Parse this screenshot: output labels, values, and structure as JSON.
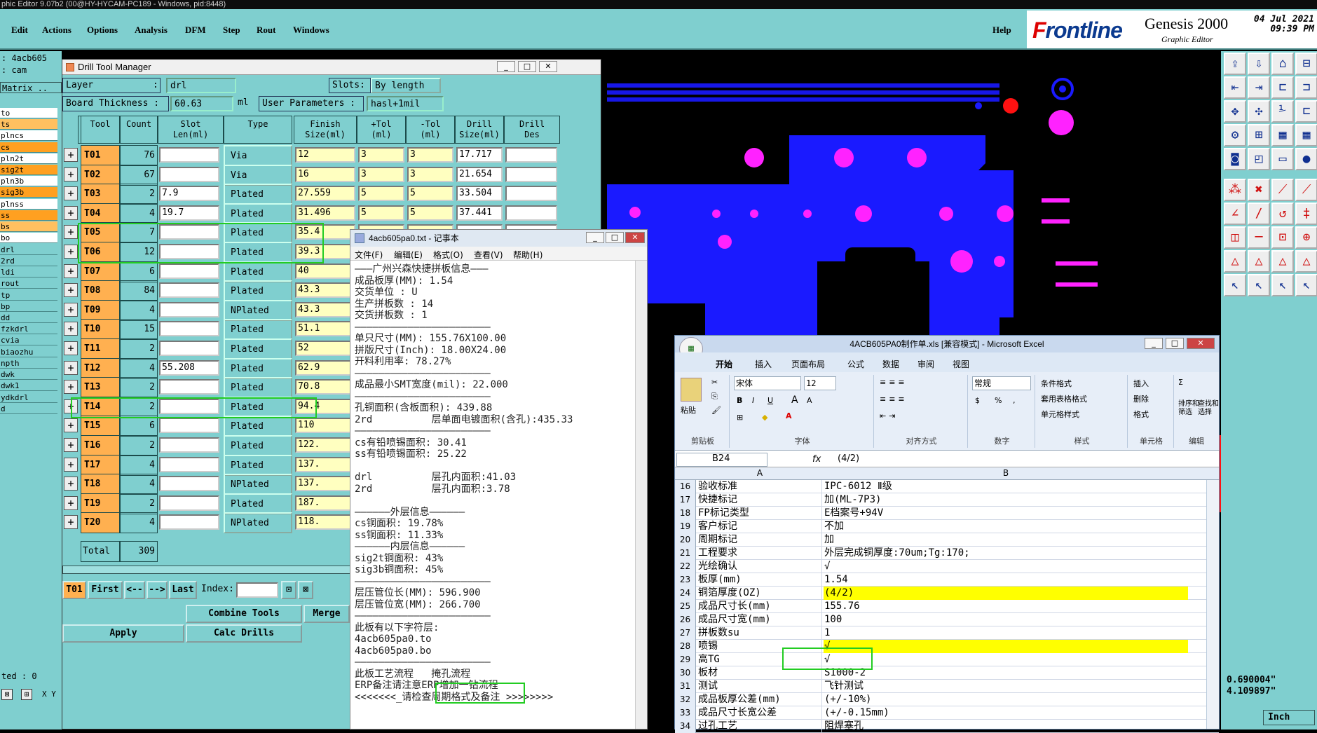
{
  "titlebar": "phic Editor 9.07b2 (00@HY-HYCAM-PC189 - Windows, pid:8448)",
  "menu": [
    "Edit",
    "Actions",
    "Options",
    "Analysis",
    "DFM",
    "Step",
    "Rout",
    "Windows"
  ],
  "help": "Help",
  "brand": {
    "logo_a": "F",
    "logo_b": "rontline",
    "product": "Genesis 2000",
    "subtitle": "Graphic Editor",
    "date": "04 Jul 2021",
    "time": "09:39 PM"
  },
  "leftpane": {
    "job": ": 4acb605",
    "step": ": cam",
    "matrix": "Matrix ..",
    "layers": [
      {
        "name": "to",
        "color": "#ffffff"
      },
      {
        "name": "ts",
        "color": "#ffc060"
      },
      {
        "name": "plncs",
        "color": "#ffffff"
      },
      {
        "name": "cs",
        "color": "#ffa020"
      },
      {
        "name": "pln2t",
        "color": "#ffffff"
      },
      {
        "name": "sig2t",
        "color": "#ffa020"
      },
      {
        "name": "pln3b",
        "color": "#ffffff"
      },
      {
        "name": "sig3b",
        "color": "#ffa020"
      },
      {
        "name": "plnss",
        "color": "#ffffff"
      },
      {
        "name": "ss",
        "color": "#ffa020"
      },
      {
        "name": "bs",
        "color": "#ffc060"
      },
      {
        "name": "bo",
        "color": "#ffffff"
      },
      {
        "name": "drl",
        "color": "#7fcfcf"
      },
      {
        "name": "2rd",
        "color": "#7fcfcf"
      },
      {
        "name": "ldi",
        "color": "#7fcfcf"
      },
      {
        "name": "rout",
        "color": "#7fcfcf"
      },
      {
        "name": "tp",
        "color": "#7fcfcf"
      },
      {
        "name": "bp",
        "color": "#7fcfcf"
      },
      {
        "name": "dd",
        "color": "#7fcfcf"
      },
      {
        "name": "fzkdrl",
        "color": "#7fcfcf"
      },
      {
        "name": "cvia",
        "color": "#7fcfcf"
      },
      {
        "name": "biaozhu",
        "color": "#7fcfcf"
      },
      {
        "name": "npth",
        "color": "#7fcfcf"
      },
      {
        "name": "dwk",
        "color": "#7fcfcf"
      },
      {
        "name": "dwk1",
        "color": "#7fcfcf"
      },
      {
        "name": "ydkdrl",
        "color": "#7fcfcf"
      },
      {
        "name": "d",
        "color": "#7fcfcf"
      }
    ],
    "selected": "ted : 0",
    "bottom_tool": "X Y"
  },
  "dtm": {
    "title": "Drill Tool Manager",
    "layer_label": "Layer",
    "layer_sep": ":",
    "layer_value": "drl",
    "slots_label": "Slots:",
    "slots_value": "By length",
    "board_label": "Board Thickness :",
    "board_value": "60.63",
    "board_unit": "ml",
    "userparams_label": "User Parameters :",
    "userparams_value": "hasl+1mil",
    "headers": [
      "Tool",
      "Count",
      "Slot\nLen(ml)",
      "Type",
      "Finish\nSize(ml)",
      "+Tol\n(ml)",
      "-Tol\n(ml)",
      "Drill\nSize(ml)",
      "Drill\nDes"
    ],
    "rows": [
      {
        "tool": "T01",
        "count": "76",
        "slot": "",
        "type": "Via",
        "finish": "12",
        "ptol": "3",
        "ntol": "3",
        "drill": "17.717"
      },
      {
        "tool": "T02",
        "count": "67",
        "slot": "",
        "type": "Via",
        "finish": "16",
        "ptol": "3",
        "ntol": "3",
        "drill": "21.654"
      },
      {
        "tool": "T03",
        "count": "2",
        "slot": "7.9",
        "type": "Plated",
        "finish": "27.559",
        "ptol": "5",
        "ntol": "5",
        "drill": "33.504"
      },
      {
        "tool": "T04",
        "count": "4",
        "slot": "19.7",
        "type": "Plated",
        "finish": "31.496",
        "ptol": "5",
        "ntol": "5",
        "drill": "37.441"
      },
      {
        "tool": "T05",
        "count": "7",
        "slot": "",
        "type": "Plated",
        "finish": "35.4",
        "ptol": "",
        "ntol": "",
        "drill": ""
      },
      {
        "tool": "T06",
        "count": "12",
        "slot": "",
        "type": "Plated",
        "finish": "39.3",
        "ptol": "",
        "ntol": "",
        "drill": ""
      },
      {
        "tool": "T07",
        "count": "6",
        "slot": "",
        "type": "Plated",
        "finish": "40",
        "ptol": "",
        "ntol": "",
        "drill": ""
      },
      {
        "tool": "T08",
        "count": "84",
        "slot": "",
        "type": "Plated",
        "finish": "43.3",
        "ptol": "",
        "ntol": "",
        "drill": ""
      },
      {
        "tool": "T09",
        "count": "4",
        "slot": "",
        "type": "NPlated",
        "finish": "43.3",
        "ptol": "",
        "ntol": "",
        "drill": ""
      },
      {
        "tool": "T10",
        "count": "15",
        "slot": "",
        "type": "Plated",
        "finish": "51.1",
        "ptol": "",
        "ntol": "",
        "drill": ""
      },
      {
        "tool": "T11",
        "count": "2",
        "slot": "",
        "type": "Plated",
        "finish": "52",
        "ptol": "",
        "ntol": "",
        "drill": ""
      },
      {
        "tool": "T12",
        "count": "4",
        "slot": "55.208",
        "type": "Plated",
        "finish": "62.9",
        "ptol": "",
        "ntol": "",
        "drill": ""
      },
      {
        "tool": "T13",
        "count": "2",
        "slot": "",
        "type": "Plated",
        "finish": "70.8",
        "ptol": "",
        "ntol": "",
        "drill": ""
      },
      {
        "tool": "T14",
        "count": "2",
        "slot": "",
        "type": "Plated",
        "finish": "94.4",
        "ptol": "",
        "ntol": "",
        "drill": ""
      },
      {
        "tool": "T15",
        "count": "6",
        "slot": "",
        "type": "Plated",
        "finish": "110",
        "ptol": "",
        "ntol": "",
        "drill": ""
      },
      {
        "tool": "T16",
        "count": "2",
        "slot": "",
        "type": "Plated",
        "finish": "122.",
        "ptol": "",
        "ntol": "",
        "drill": ""
      },
      {
        "tool": "T17",
        "count": "4",
        "slot": "",
        "type": "Plated",
        "finish": "137.",
        "ptol": "",
        "ntol": "",
        "drill": ""
      },
      {
        "tool": "T18",
        "count": "4",
        "slot": "",
        "type": "NPlated",
        "finish": "137.",
        "ptol": "",
        "ntol": "",
        "drill": ""
      },
      {
        "tool": "T19",
        "count": "2",
        "slot": "",
        "type": "Plated",
        "finish": "187.",
        "ptol": "",
        "ntol": "",
        "drill": ""
      },
      {
        "tool": "T20",
        "count": "4",
        "slot": "",
        "type": "NPlated",
        "finish": "118.",
        "ptol": "",
        "ntol": "",
        "drill": ""
      }
    ],
    "total_label": "Total",
    "total_value": "309",
    "nav": {
      "current": "T01",
      "first": "First",
      "prev": "<--",
      "next": "-->",
      "last": "Last",
      "index_label": "Index:"
    },
    "combine": "Combine Tools",
    "merge": "Merge",
    "apply": "Apply",
    "calc": "Calc Drills"
  },
  "notepad": {
    "title": "4acb605pa0.txt - 记事本",
    "menu": [
      "文件(F)",
      "编辑(E)",
      "格式(O)",
      "查看(V)",
      "帮助(H)"
    ],
    "lines": [
      "———广州兴森快捷拼板信息———",
      "成品板厚(MM): 1.54",
      "交货单位 : U",
      "生产拼板数 : 14",
      "交货拼板数 : 1",
      "———————————————————————",
      "单只尺寸(MM): 155.76X100.00",
      "拼版尺寸(Inch): 18.00X24.00",
      "开料利用率: 78.27%",
      "———————————————————————",
      "成品最小SMT宽度(mil): 22.000",
      "———————————————————————",
      "孔铜面积(含板面积): 439.88",
      "2rd          层单面电镀面积(含孔):435.33",
      "———————————————————————",
      "cs有铅喷锡面积: 30.41",
      "ss有铅喷锡面积: 25.22",
      "",
      "drl          层孔内面积:41.03",
      "2rd          层孔内面积:3.78",
      "",
      "——————外层信息——————",
      "cs铜面积: 19.78%",
      "ss铜面积: 11.33%",
      "——————内层信息——————",
      "sig2t铜面积: 43%",
      "sig3b铜面积: 45%",
      "———————————————————————",
      "层压管位长(MM): 596.900",
      "层压管位宽(MM): 266.700",
      "———————————————————————",
      "此板有以下字符层:",
      "4acb605pa0.to",
      "4acb605pa0.bo",
      "———————————————————————",
      "此板工艺流程   掩孔流程",
      "ERP备注请注意ERP增加一钻流程",
      "<<<<<<<_请检查周期格式及备注_>>>>>>>>"
    ]
  },
  "excel": {
    "title": "4ACB605PA0制作单.xls [兼容模式] - Microsoft Excel",
    "tabs": [
      "开始",
      "插入",
      "页面布局",
      "公式",
      "数据",
      "审阅",
      "视图"
    ],
    "font_name": "宋体",
    "font_size": "12",
    "number_format": "常规",
    "groups": [
      "剪贴板",
      "字体",
      "对齐方式",
      "数字",
      "样式",
      "单元格",
      "编辑"
    ],
    "paste": "粘贴",
    "cond": "条件格式",
    "tablefmt": "套用表格格式",
    "cellstyle": "单元格样式",
    "insert": "插入",
    "delete": "删除",
    "format": "格式",
    "sort": "排序和\n筛选",
    "find": "查找和\n选择",
    "name_box": "B24",
    "formula": "(4/2)",
    "col_a": "A",
    "col_b": "B",
    "rows": [
      {
        "n": "16",
        "a": "验收标准",
        "b": "IPC-6012 Ⅱ级",
        "y": false
      },
      {
        "n": "17",
        "a": "快捷标记",
        "b": "加(ML-7P3)",
        "y": false
      },
      {
        "n": "18",
        "a": "FP标记类型",
        "b": "E档案号+94V",
        "y": false
      },
      {
        "n": "19",
        "a": "客户标记",
        "b": "不加",
        "y": false
      },
      {
        "n": "20",
        "a": "周期标记",
        "b": "加",
        "y": false
      },
      {
        "n": "21",
        "a": "工程要求",
        "b": "外层完成铜厚度:70um;Tg:170;",
        "y": false
      },
      {
        "n": "22",
        "a": "光绘确认",
        "b": "√",
        "y": false
      },
      {
        "n": "23",
        "a": "板厚(mm)",
        "b": "1.54",
        "y": false
      },
      {
        "n": "24",
        "a": "铜箔厚度(OZ)",
        "b": "(4/2)",
        "y": true
      },
      {
        "n": "25",
        "a": "成品尺寸长(mm)",
        "b": "155.76",
        "y": false
      },
      {
        "n": "26",
        "a": "成品尺寸宽(mm)",
        "b": "100",
        "y": false
      },
      {
        "n": "27",
        "a": "拼板数su",
        "b": "1",
        "y": false
      },
      {
        "n": "28",
        "a": "喷锡",
        "b": "√",
        "y": true
      },
      {
        "n": "29",
        "a": "高TG",
        "b": "√",
        "y": false
      },
      {
        "n": "30",
        "a": "板材",
        "b": "S1000-2",
        "y": false
      },
      {
        "n": "31",
        "a": "测试",
        "b": "飞针测试",
        "y": false
      },
      {
        "n": "32",
        "a": "成品板厚公差(mm)",
        "b": "(+/-10%)",
        "y": false
      },
      {
        "n": "33",
        "a": "成品尺寸长宽公差",
        "b": "(+/-0.15mm)",
        "y": false
      },
      {
        "n": "34",
        "a": "过孔工艺",
        "b": "阻焊塞孔",
        "y": false
      }
    ]
  },
  "coords": {
    "x": "0.690004\"",
    "y": "4.109897\""
  },
  "units": "Inch",
  "colors": {
    "panel": "#7fcfcf",
    "copper": "#1a1aff",
    "pad": "#ff22ff",
    "highlight": "#22cc22",
    "excel_yellow": "#ffff00"
  }
}
